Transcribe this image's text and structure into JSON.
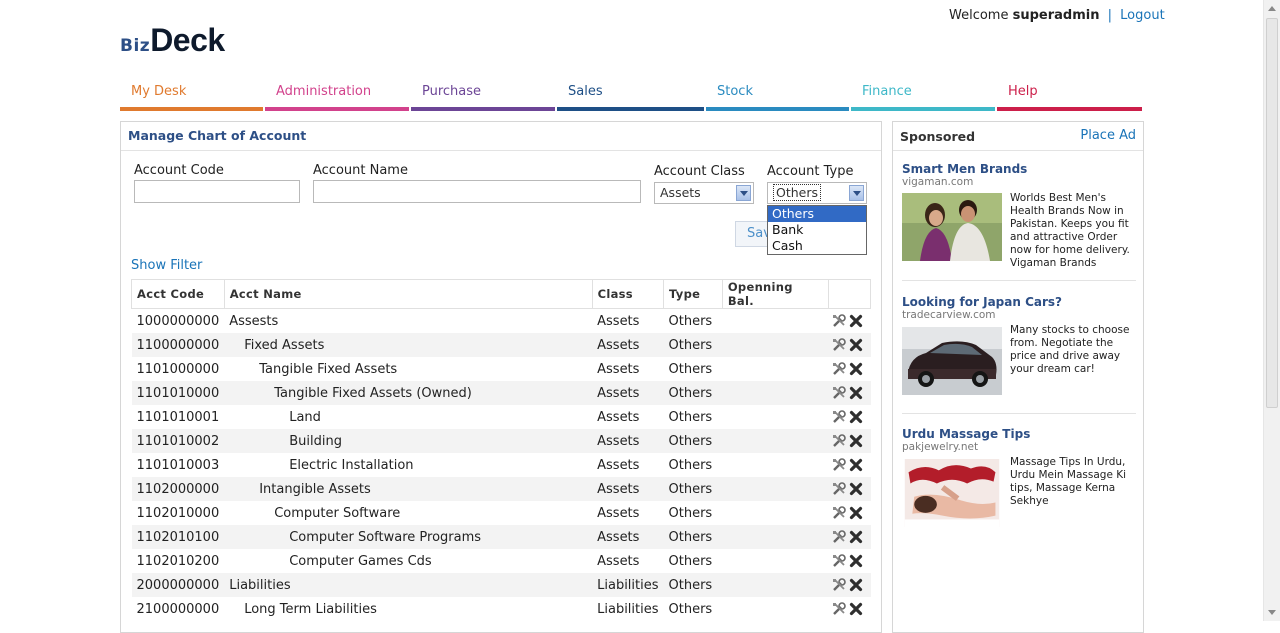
{
  "header": {
    "welcome_prefix": "Welcome",
    "username": "superadmin",
    "separator": "|",
    "logout": "Logout",
    "logo_small": "Biz",
    "logo_big": "Deck"
  },
  "nav": [
    {
      "label": "My Desk",
      "color": "#e07a2e"
    },
    {
      "label": "Administration",
      "color": "#d2428c"
    },
    {
      "label": "Purchase",
      "color": "#6c4596"
    },
    {
      "label": "Sales",
      "color": "#1e4f86"
    },
    {
      "label": "Stock",
      "color": "#2a8bc0"
    },
    {
      "label": "Finance",
      "color": "#3eb8c8"
    },
    {
      "label": "Help",
      "color": "#cc1f4a"
    }
  ],
  "panel": {
    "title": "Manage Chart of Account",
    "account_code_label": "Account Code",
    "account_code_value": "",
    "account_name_label": "Account Name",
    "account_name_value": "",
    "account_class_label": "Account Class",
    "account_class_value": "Assets",
    "account_type_label": "Account Type",
    "account_type_value": "Others",
    "account_type_options": [
      "Others",
      "Bank",
      "Cash"
    ],
    "save_label": "Save",
    "show_filter": "Show Filter"
  },
  "table": {
    "headers": [
      "Acct Code",
      "Acct Name",
      "Class",
      "Type",
      "Openning Bal.",
      ""
    ],
    "rows": [
      {
        "code": "1000000000",
        "name": "Assests",
        "level": 0,
        "class": "Assets",
        "type": "Others",
        "bal": ""
      },
      {
        "code": "1100000000",
        "name": "Fixed Assets",
        "level": 1,
        "class": "Assets",
        "type": "Others",
        "bal": ""
      },
      {
        "code": "1101000000",
        "name": "Tangible Fixed Assets",
        "level": 2,
        "class": "Assets",
        "type": "Others",
        "bal": ""
      },
      {
        "code": "1101010000",
        "name": "Tangible Fixed Assets (Owned)",
        "level": 3,
        "class": "Assets",
        "type": "Others",
        "bal": ""
      },
      {
        "code": "1101010001",
        "name": "Land",
        "level": 4,
        "class": "Assets",
        "type": "Others",
        "bal": ""
      },
      {
        "code": "1101010002",
        "name": "Building",
        "level": 4,
        "class": "Assets",
        "type": "Others",
        "bal": ""
      },
      {
        "code": "1101010003",
        "name": "Electric Installation",
        "level": 4,
        "class": "Assets",
        "type": "Others",
        "bal": ""
      },
      {
        "code": "1102000000",
        "name": "Intangible Assets",
        "level": 2,
        "class": "Assets",
        "type": "Others",
        "bal": ""
      },
      {
        "code": "1102010000",
        "name": "Computer Software",
        "level": 3,
        "class": "Assets",
        "type": "Others",
        "bal": ""
      },
      {
        "code": "1102010100",
        "name": "Computer Software Programs",
        "level": 4,
        "class": "Assets",
        "type": "Others",
        "bal": ""
      },
      {
        "code": "1102010200",
        "name": "Computer Games Cds",
        "level": 4,
        "class": "Assets",
        "type": "Others",
        "bal": ""
      },
      {
        "code": "2000000000",
        "name": "Liabilities",
        "level": 0,
        "class": "Liabilities",
        "type": "Others",
        "bal": ""
      },
      {
        "code": "2100000000",
        "name": "Long Term Liabilities",
        "level": 1,
        "class": "Liabilities",
        "type": "Others",
        "bal": ""
      }
    ],
    "edit_icon": "tools-icon",
    "delete_icon": "delete-x-icon"
  },
  "sponsored": {
    "title": "Sponsored",
    "place_ad": "Place Ad",
    "ads": [
      {
        "title": "Smart Men Brands",
        "url": "vigaman.com",
        "text": "Worlds Best Men's Health Brands Now in Pakistan. Keeps you fit and attractive Order now for home delivery. Vigaman Brands",
        "image": "couple-photo"
      },
      {
        "title": "Looking for Japan Cars?",
        "url": "tradecarview.com",
        "text": "Many stocks to choose from. Negotiate the price and drive away your dream car!",
        "image": "car-photo"
      },
      {
        "title": "Urdu Massage Tips",
        "url": "pakjewelry.net",
        "text": "Massage Tips In Urdu, Urdu Mein Massage Ki tips, Massage Kerna Sekhye",
        "image": "massage-photo"
      }
    ]
  }
}
